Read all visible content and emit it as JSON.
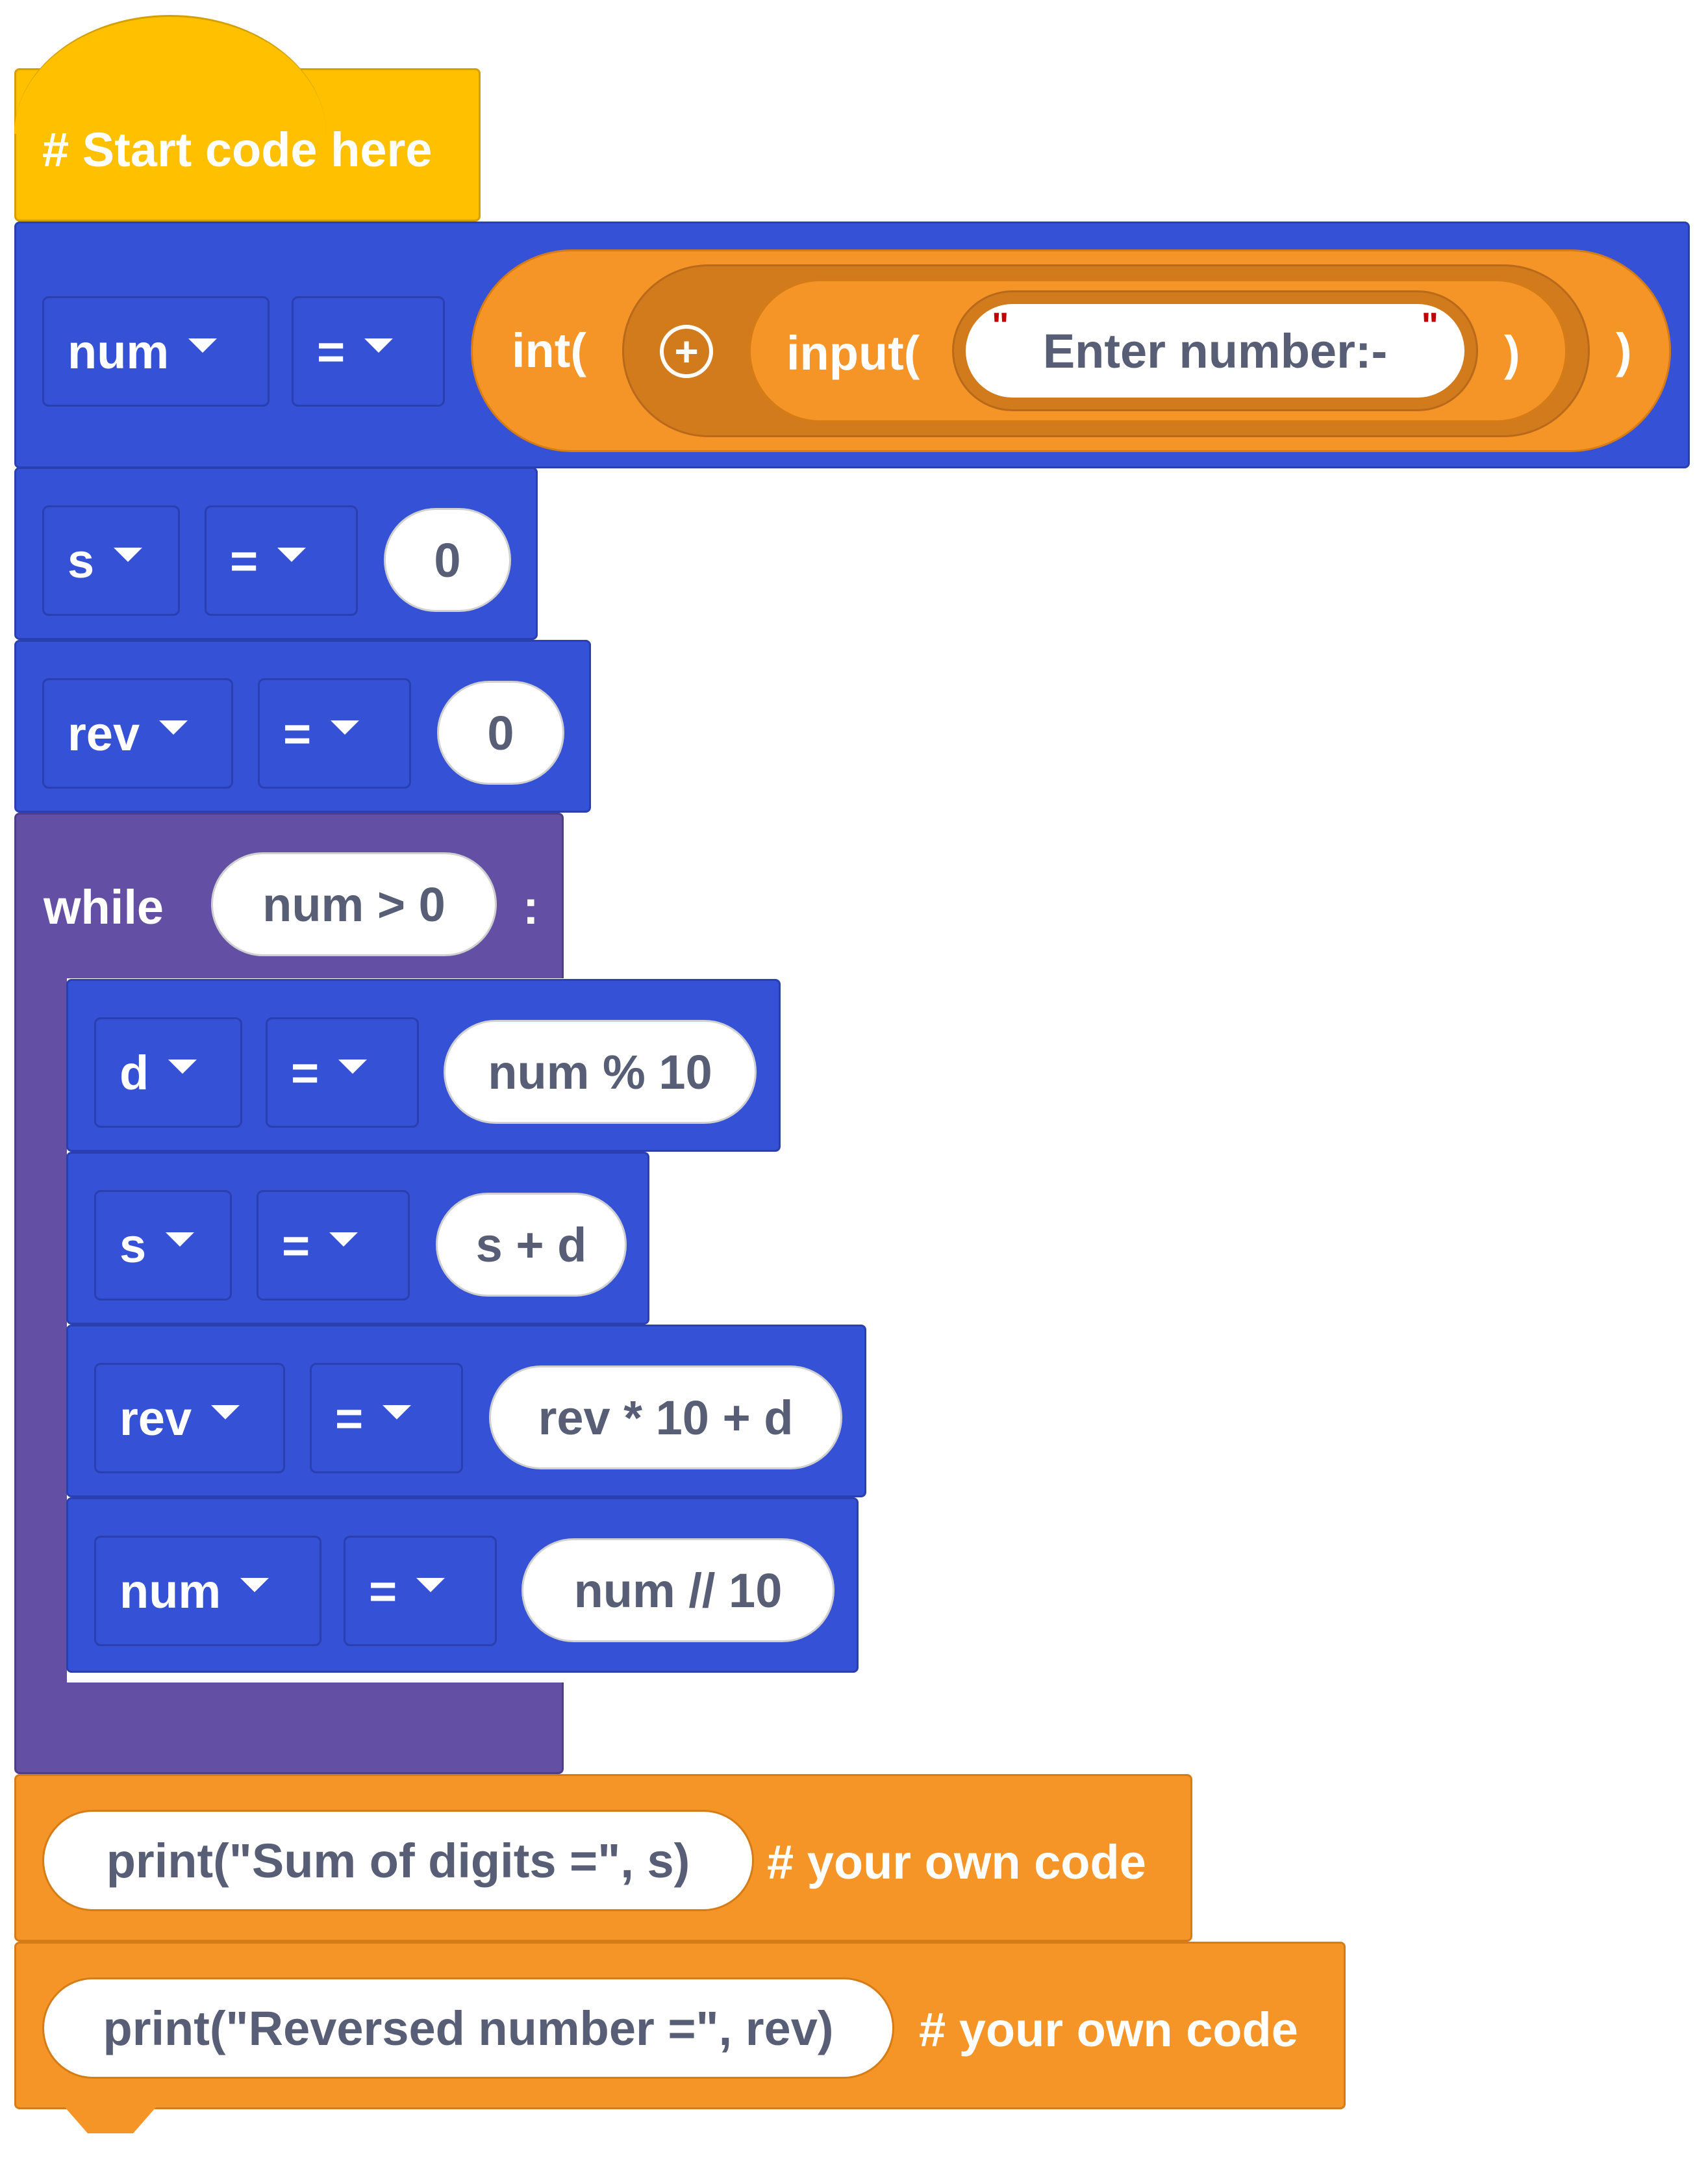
{
  "hat": {
    "label": "# Start code here"
  },
  "line1": {
    "var": "num",
    "op": "=",
    "int_label": "int(",
    "plus_icon": "plus-circle-icon",
    "input_label": "input(",
    "quote_open": "\"",
    "string_value": "Enter number:-",
    "quote_close": "\"",
    "close_inner": ")",
    "close_outer": ")"
  },
  "line2": {
    "var": "s",
    "op": "=",
    "value": "0"
  },
  "line3": {
    "var": "rev",
    "op": "=",
    "value": "0"
  },
  "while_block": {
    "keyword": "while",
    "condition": "num > 0",
    "colon": ":"
  },
  "body": [
    {
      "var": "d",
      "op": "=",
      "value": "num % 10"
    },
    {
      "var": "s",
      "op": "=",
      "value": "s + d"
    },
    {
      "var": "rev",
      "op": "=",
      "value": "rev * 10 + d"
    },
    {
      "var": "num",
      "op": "=",
      "value": "num // 10"
    }
  ],
  "print1": {
    "code": "print(\"Sum of digits =\", s)",
    "comment": "# your own code"
  },
  "print2": {
    "code": "print(\"Reversed number =\", rev)",
    "comment": "# your own code"
  },
  "colors": {
    "blue": "#3551d6",
    "purple": "#634fa3",
    "orange": "#f59527",
    "yellow": "#ffc000",
    "dark_orange": "#d17b1d"
  }
}
